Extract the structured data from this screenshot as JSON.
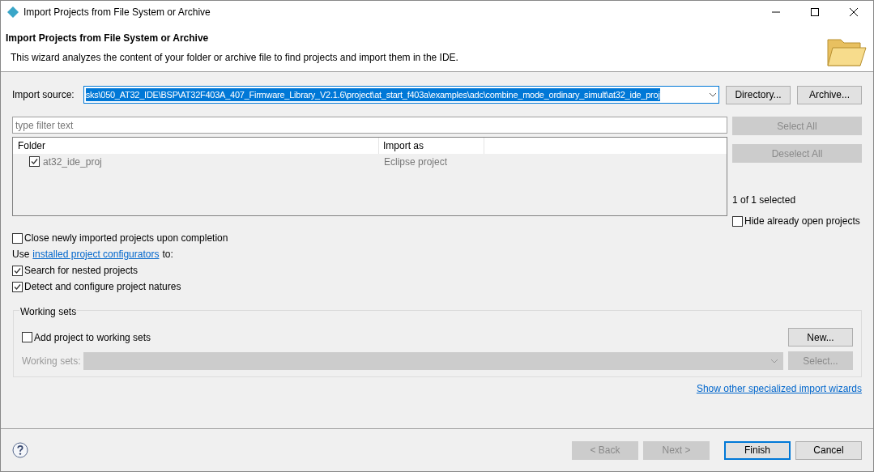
{
  "window": {
    "title": "Import Projects from File System or Archive"
  },
  "header": {
    "title": "Import Projects from File System or Archive",
    "description": "This wizard analyzes the content of your folder or archive file to find projects and import them in the IDE."
  },
  "import_source": {
    "label": "Import source:",
    "value": "sks\\050_AT32_IDE\\BSP\\AT32F403A_407_Firmware_Library_V2.1.6\\project\\at_start_f403a\\examples\\adc\\combine_mode_ordinary_simult\\at32_ide_proj",
    "buttons": [
      {
        "label": "Directory...",
        "disabled": false
      },
      {
        "label": "Archive...",
        "disabled": false
      }
    ]
  },
  "filter": {
    "placeholder": "type filter text"
  },
  "table": {
    "columns": [
      "Folder",
      "Import as"
    ],
    "rows": [
      {
        "folder": "at32_ide_proj",
        "import_as": "Eclipse project",
        "checked": true
      }
    ]
  },
  "side_buttons": [
    {
      "label": "Select All",
      "disabled": true
    },
    {
      "label": "Deselect All",
      "disabled": true
    }
  ],
  "selection_count": "1 of 1 selected",
  "hide_open": {
    "label": "Hide already open projects",
    "checked": false
  },
  "close_imported": {
    "label": "Close newly imported projects upon completion",
    "checked": false
  },
  "configurators": {
    "prefix": "Use",
    "link": "installed project configurators",
    "suffix": "to:"
  },
  "options": [
    {
      "label": "Search for nested projects",
      "checked": true
    },
    {
      "label": "Detect and configure project natures",
      "checked": true
    }
  ],
  "working_sets": {
    "title": "Working sets",
    "add": {
      "label": "Add project to working sets",
      "checked": false
    },
    "field_label": "Working sets:",
    "disabled": true,
    "buttons": [
      {
        "label": "New...",
        "disabled": false
      },
      {
        "label": "Select...",
        "disabled": true
      }
    ]
  },
  "other_wizards_link": "Show other specialized import wizards",
  "footer_buttons": [
    {
      "label": "< Back",
      "disabled": true,
      "default": false
    },
    {
      "label": "Next >",
      "disabled": true,
      "default": false
    },
    {
      "label": "Finish",
      "disabled": false,
      "default": true
    },
    {
      "label": "Cancel",
      "disabled": false,
      "default": false
    }
  ]
}
